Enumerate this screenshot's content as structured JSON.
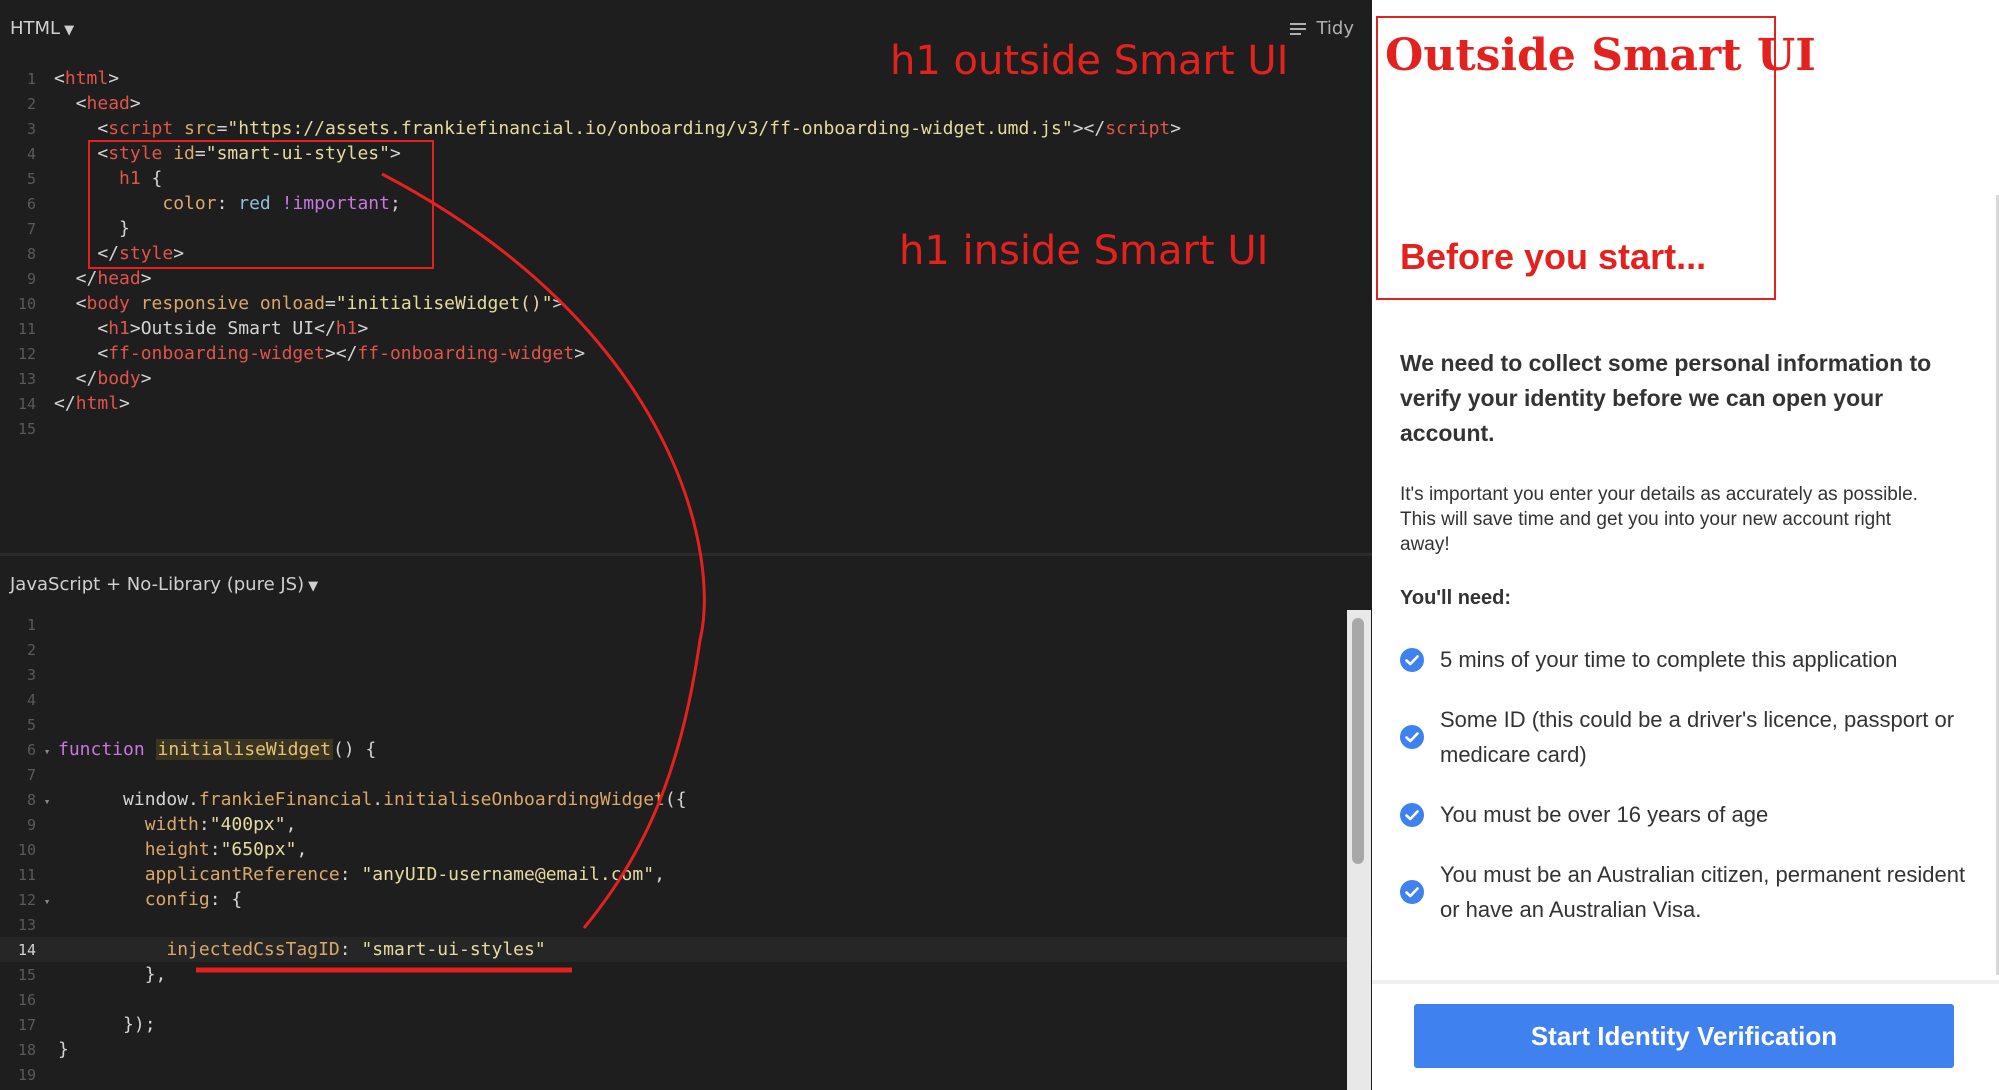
{
  "html_pane": {
    "title": "HTML",
    "tidy_label": "Tidy",
    "lines": [
      {
        "n": "1",
        "tokens": [
          {
            "t": "<",
            "c": "txt"
          },
          {
            "t": "html",
            "c": "tag"
          },
          {
            "t": ">",
            "c": "txt"
          }
        ]
      },
      {
        "n": "2",
        "tokens": [
          {
            "t": "  <",
            "c": "txt"
          },
          {
            "t": "head",
            "c": "tag"
          },
          {
            "t": ">",
            "c": "txt"
          }
        ]
      },
      {
        "n": "3",
        "tokens": [
          {
            "t": "    <",
            "c": "txt"
          },
          {
            "t": "script",
            "c": "tag"
          },
          {
            "t": " src",
            "c": "attr"
          },
          {
            "t": "=",
            "c": "txt"
          },
          {
            "t": "\"https://assets.frankiefinancial.io/onboarding/v3/ff-onboarding-widget.umd.js\"",
            "c": "str"
          },
          {
            "t": "></",
            "c": "txt"
          },
          {
            "t": "script",
            "c": "tag"
          },
          {
            "t": ">",
            "c": "txt"
          }
        ]
      },
      {
        "n": "4",
        "tokens": [
          {
            "t": "    <",
            "c": "txt"
          },
          {
            "t": "style",
            "c": "tag"
          },
          {
            "t": " id",
            "c": "attr"
          },
          {
            "t": "=",
            "c": "txt"
          },
          {
            "t": "\"smart-ui-styles\"",
            "c": "str"
          },
          {
            "t": ">",
            "c": "txt"
          }
        ]
      },
      {
        "n": "5",
        "tokens": [
          {
            "t": "      ",
            "c": "txt"
          },
          {
            "t": "h1",
            "c": "tag"
          },
          {
            "t": " {",
            "c": "txt"
          }
        ]
      },
      {
        "n": "6",
        "tokens": [
          {
            "t": "          ",
            "c": "txt"
          },
          {
            "t": "color",
            "c": "prop"
          },
          {
            "t": ": ",
            "c": "txt"
          },
          {
            "t": "red",
            "c": "ident"
          },
          {
            "t": " !important",
            "c": "kw"
          },
          {
            "t": ";",
            "c": "txt"
          }
        ]
      },
      {
        "n": "7",
        "tokens": [
          {
            "t": "      }",
            "c": "txt"
          }
        ]
      },
      {
        "n": "8",
        "tokens": [
          {
            "t": "    </",
            "c": "txt"
          },
          {
            "t": "style",
            "c": "tag"
          },
          {
            "t": ">",
            "c": "txt"
          }
        ]
      },
      {
        "n": "9",
        "tokens": [
          {
            "t": "  </",
            "c": "txt"
          },
          {
            "t": "head",
            "c": "tag"
          },
          {
            "t": ">",
            "c": "txt"
          }
        ]
      },
      {
        "n": "10",
        "tokens": [
          {
            "t": "  <",
            "c": "txt"
          },
          {
            "t": "body",
            "c": "tag"
          },
          {
            "t": " responsive onload",
            "c": "attr"
          },
          {
            "t": "=",
            "c": "txt"
          },
          {
            "t": "\"initialiseWidget()\"",
            "c": "str"
          },
          {
            "t": ">",
            "c": "txt"
          }
        ]
      },
      {
        "n": "11",
        "tokens": [
          {
            "t": "    <",
            "c": "txt"
          },
          {
            "t": "h1",
            "c": "tag"
          },
          {
            "t": ">Outside Smart UI</",
            "c": "txt"
          },
          {
            "t": "h1",
            "c": "tag"
          },
          {
            "t": ">",
            "c": "txt"
          }
        ]
      },
      {
        "n": "12",
        "tokens": [
          {
            "t": "    <",
            "c": "txt"
          },
          {
            "t": "ff-onboarding-widget",
            "c": "tag"
          },
          {
            "t": "></",
            "c": "txt"
          },
          {
            "t": "ff-onboarding-widget",
            "c": "tag"
          },
          {
            "t": ">",
            "c": "txt"
          }
        ]
      },
      {
        "n": "13",
        "tokens": [
          {
            "t": "  </",
            "c": "txt"
          },
          {
            "t": "body",
            "c": "tag"
          },
          {
            "t": ">",
            "c": "txt"
          }
        ]
      },
      {
        "n": "14",
        "tokens": [
          {
            "t": "</",
            "c": "txt"
          },
          {
            "t": "html",
            "c": "tag"
          },
          {
            "t": ">",
            "c": "txt"
          }
        ]
      },
      {
        "n": "15",
        "tokens": []
      }
    ]
  },
  "js_pane": {
    "title": "JavaScript + No-Library (pure JS)",
    "lines": [
      {
        "n": "1",
        "fold": "",
        "tokens": []
      },
      {
        "n": "2",
        "fold": "",
        "tokens": []
      },
      {
        "n": "3",
        "fold": "",
        "tokens": []
      },
      {
        "n": "4",
        "fold": "",
        "tokens": []
      },
      {
        "n": "5",
        "fold": "",
        "tokens": []
      },
      {
        "n": "6",
        "fold": "▾",
        "tokens": [
          {
            "t": "function",
            "c": "kw"
          },
          {
            "t": " ",
            "c": "txt"
          },
          {
            "t": "initialiseWidget",
            "c": "fn",
            "hl": true
          },
          {
            "t": "() {",
            "c": "txt"
          }
        ]
      },
      {
        "n": "7",
        "fold": "",
        "tokens": []
      },
      {
        "n": "8",
        "fold": "▾",
        "tokens": [
          {
            "t": "      window.",
            "c": "plain"
          },
          {
            "t": "frankieFinancial",
            "c": "prop"
          },
          {
            "t": ".",
            "c": "plain"
          },
          {
            "t": "initialiseOnboardingWidget",
            "c": "prop"
          },
          {
            "t": "({",
            "c": "plain"
          }
        ]
      },
      {
        "n": "9",
        "fold": "",
        "tokens": [
          {
            "t": "        ",
            "c": "txt"
          },
          {
            "t": "width",
            "c": "prop"
          },
          {
            "t": ":",
            "c": "txt"
          },
          {
            "t": "\"400px\"",
            "c": "str"
          },
          {
            "t": ",",
            "c": "txt"
          }
        ]
      },
      {
        "n": "10",
        "fold": "",
        "tokens": [
          {
            "t": "        ",
            "c": "txt"
          },
          {
            "t": "height",
            "c": "prop"
          },
          {
            "t": ":",
            "c": "txt"
          },
          {
            "t": "\"650px\"",
            "c": "str"
          },
          {
            "t": ",",
            "c": "txt"
          }
        ]
      },
      {
        "n": "11",
        "fold": "",
        "tokens": [
          {
            "t": "        ",
            "c": "txt"
          },
          {
            "t": "applicantReference",
            "c": "prop"
          },
          {
            "t": ": ",
            "c": "txt"
          },
          {
            "t": "\"anyUID-username@email.com\"",
            "c": "str"
          },
          {
            "t": ",",
            "c": "txt"
          }
        ]
      },
      {
        "n": "12",
        "fold": "▾",
        "tokens": [
          {
            "t": "        ",
            "c": "txt"
          },
          {
            "t": "config",
            "c": "prop"
          },
          {
            "t": ": {",
            "c": "txt"
          }
        ]
      },
      {
        "n": "13",
        "fold": "",
        "tokens": []
      },
      {
        "n": "14",
        "fold": "",
        "current": true,
        "tokens": [
          {
            "t": "          ",
            "c": "txt"
          },
          {
            "t": "injectedCssTagID",
            "c": "prop"
          },
          {
            "t": ": ",
            "c": "txt"
          },
          {
            "t": "\"smart-ui-styles\"",
            "c": "str"
          }
        ]
      },
      {
        "n": "15",
        "fold": "",
        "tokens": [
          {
            "t": "        },",
            "c": "txt"
          }
        ]
      },
      {
        "n": "16",
        "fold": "",
        "tokens": []
      },
      {
        "n": "17",
        "fold": "",
        "tokens": [
          {
            "t": "      });",
            "c": "txt"
          }
        ]
      },
      {
        "n": "18",
        "fold": "",
        "tokens": [
          {
            "t": "}",
            "c": "txt"
          }
        ]
      },
      {
        "n": "19",
        "fold": "",
        "tokens": []
      }
    ]
  },
  "annotations": {
    "outside_label": "h1 outside Smart UI",
    "inside_label": "h1 inside Smart UI",
    "accent_color": "#e3221f"
  },
  "preview": {
    "h1": "Outside Smart UI",
    "widget_heading": "Before you start...",
    "lead": "We need to collect some personal information to verify your identity before we can open your account.",
    "body": "It's important you enter your details as accurately as possible. This will save time and get you into your new account right away!",
    "need_label": "You'll need:",
    "items": [
      "5 mins of your time to complete this application",
      "Some ID (this could be a driver's licence, passport or medicare card)",
      "You must be over 16 years of age",
      "You must be an Australian citizen, permanent resident or have an Australian Visa."
    ],
    "check_icon": "check-circle-icon",
    "button_label": "Start Identity Verification",
    "button_color": "#3f82ef"
  }
}
